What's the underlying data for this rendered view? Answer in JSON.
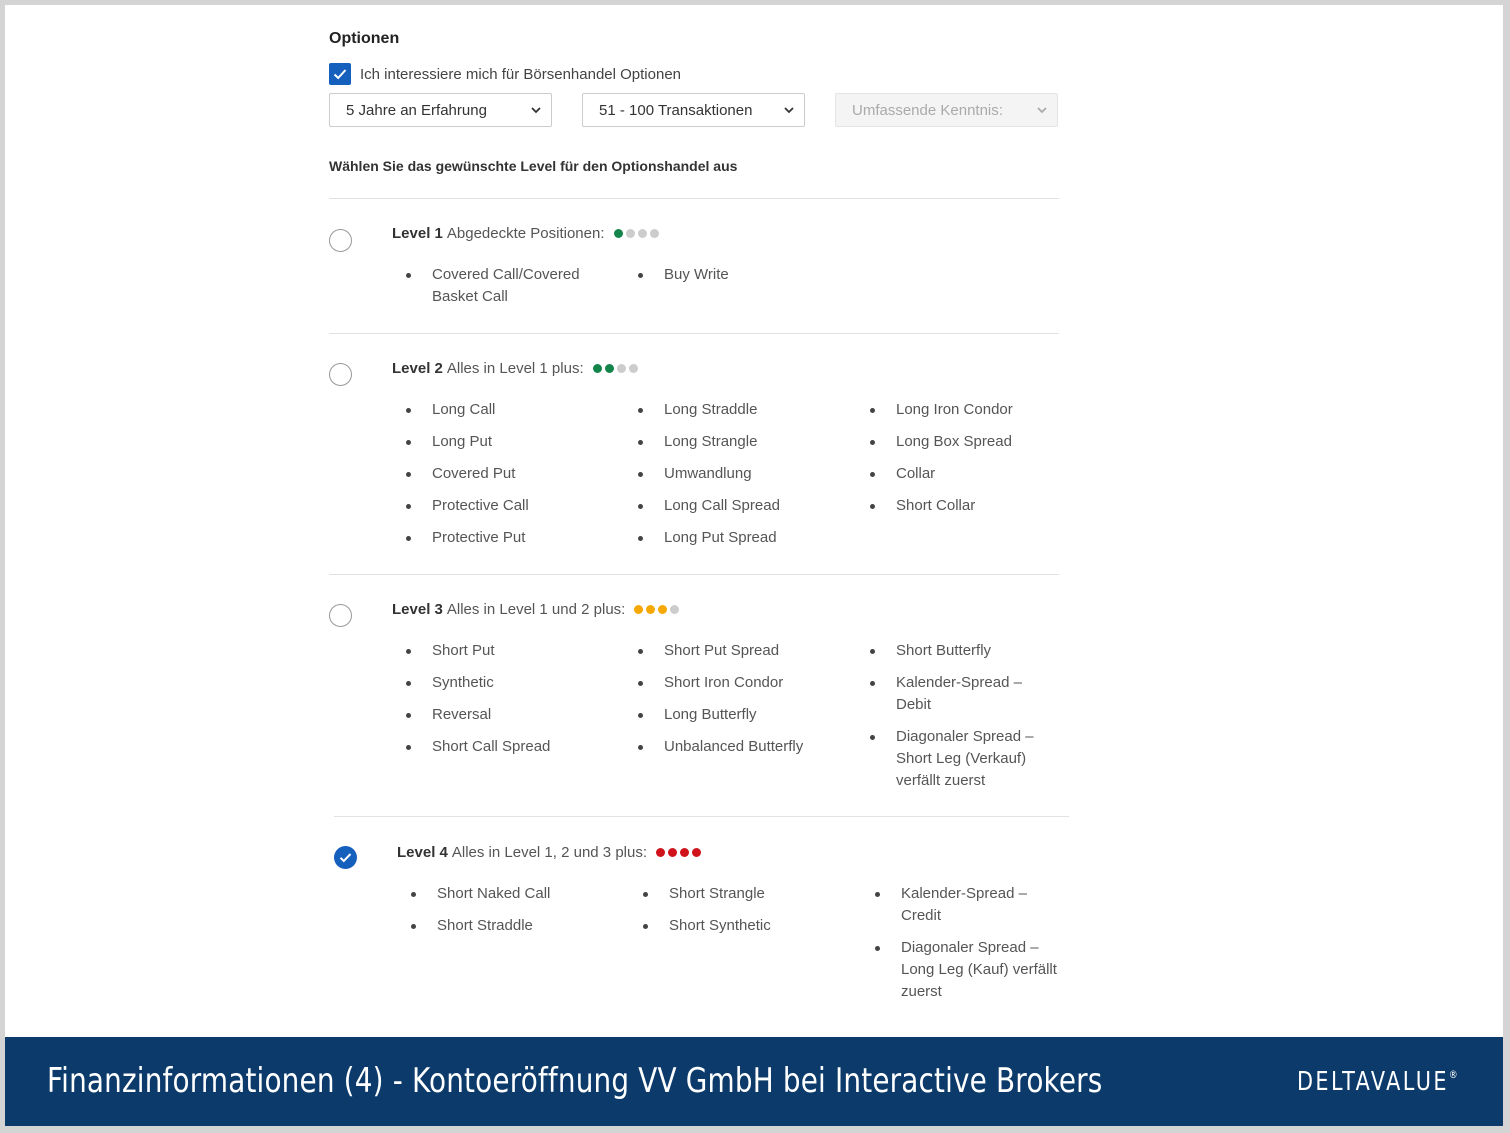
{
  "options": {
    "title": "Optionen",
    "interest_label": "Ich interessiere mich für Börsenhandel Optionen",
    "interest_checked": true,
    "experience_select": "5 Jahre an Erfahrung",
    "transactions_select": "51 - 100 Transaktionen",
    "knowledge_select": "Umfassende Kenntnis:",
    "level_prompt": "Wählen Sie das gewünschte Level für den Optionshandel aus"
  },
  "levels": [
    {
      "label": "Level 1",
      "desc": "Abgedeckte Positionen:",
      "selected": false,
      "dots": [
        "#13854a",
        "#cccccc",
        "#cccccc",
        "#cccccc"
      ],
      "columns": [
        [
          "Covered Call/Covered Basket Call"
        ],
        [
          "Buy Write"
        ]
      ]
    },
    {
      "label": "Level 2",
      "desc": "Alles in Level 1 plus:",
      "selected": false,
      "dots": [
        "#13854a",
        "#13854a",
        "#cccccc",
        "#cccccc"
      ],
      "columns": [
        [
          "Long Call",
          "Long Put",
          "Covered Put",
          "Protective Call",
          "Protective Put"
        ],
        [
          "Long Straddle",
          "Long Strangle",
          "Umwandlung",
          "Long Call Spread",
          "Long Put Spread"
        ],
        [
          "Long Iron Condor",
          "Long Box Spread",
          "Collar",
          "Short Collar"
        ]
      ]
    },
    {
      "label": "Level 3",
      "desc": "Alles in Level 1 und 2 plus:",
      "selected": false,
      "dots": [
        "#f5a800",
        "#f5a800",
        "#f5a800",
        "#cccccc"
      ],
      "columns": [
        [
          "Short Put",
          "Synthetic",
          "Reversal",
          "Short Call Spread"
        ],
        [
          "Short Put Spread",
          "Short Iron Condor",
          "Long Butterfly",
          "Unbalanced Butterfly"
        ],
        [
          "Short Butterfly",
          "Kalender-Spread – Debit",
          "Diagonaler Spread – Short Leg (Verkauf) verfällt zuerst"
        ]
      ]
    },
    {
      "label": "Level 4",
      "desc": "Alles in Level 1, 2 und 3 plus:",
      "selected": true,
      "dots": [
        "#d0121b",
        "#d0121b",
        "#d0121b",
        "#d0121b"
      ],
      "columns": [
        [
          "Short Naked Call",
          "Short Straddle"
        ],
        [
          "Short Strangle",
          "Short Synthetic"
        ],
        [
          "Kalender-Spread – Credit",
          "Diagonaler Spread – Long Leg (Kauf) verfällt zuerst"
        ]
      ]
    }
  ],
  "footer": {
    "title": "Finanzinformationen (4) - Kontoeröffnung VV GmbH bei Interactive Brokers",
    "logo": "DELTAVALUE",
    "logo_mark": "®"
  }
}
